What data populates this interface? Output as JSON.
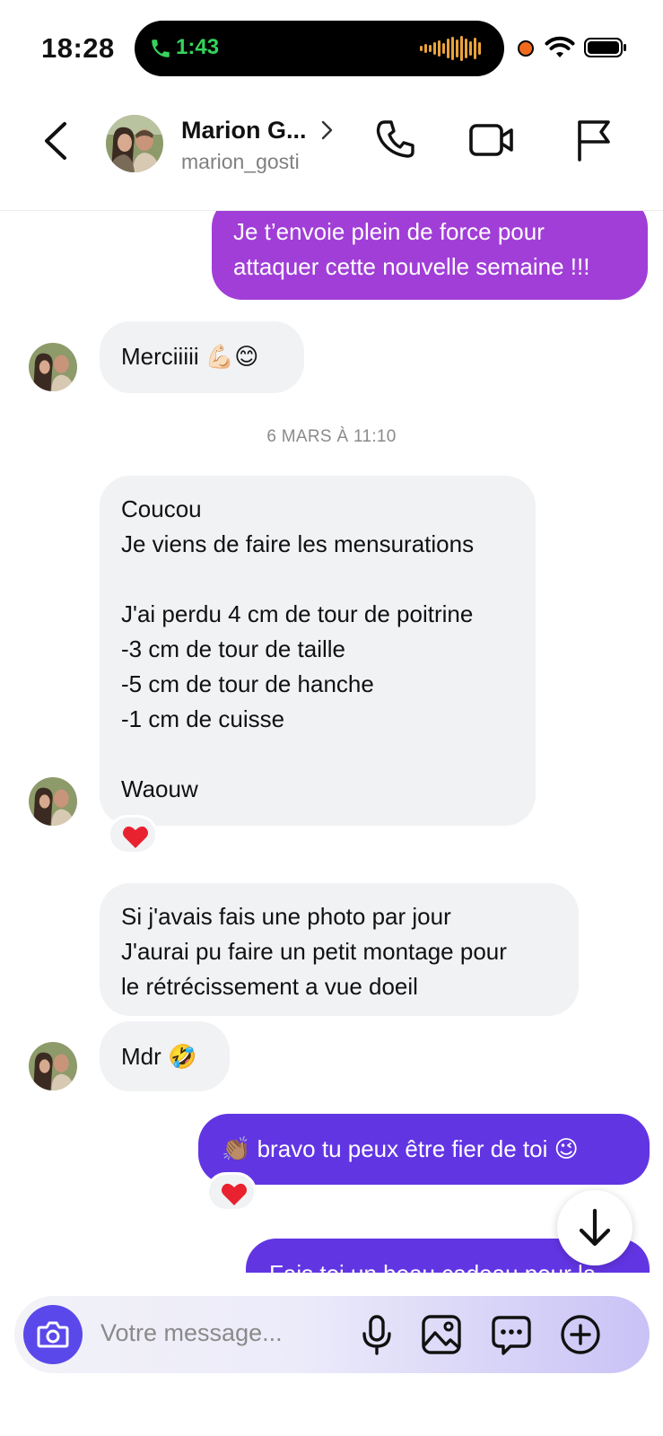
{
  "status_bar": {
    "time": "18:28",
    "call_duration": "1:43"
  },
  "header": {
    "name": "Marion G...",
    "username": "marion_gosti"
  },
  "messages": {
    "m1": "Je t’envoie plein de force pour\nattaquer cette nouvelle semaine !!!",
    "m2": "Merciiiii 💪🏻😊",
    "date_sep": "6 MARS À 11:10",
    "m3": "Coucou\nJe viens de faire les mensurations\n\nJ'ai perdu 4 cm de tour de poitrine\n-3 cm de tour de taille\n-5 cm de tour de hanche\n-1 cm de cuisse\n\nWaouw",
    "m4": "Si j'avais fais une photo par jour\nJ'aurai pu faire un petit montage pour\nle rétrécissement a vue doeil",
    "m5": "Mdr 🤣",
    "m6": "👏🏽 bravo tu peux être fier de toi 😉",
    "m7": "Fais toi un beau cadeau pour la"
  },
  "reactions": {
    "heart": "❤️"
  },
  "composer": {
    "placeholder": "Votre message..."
  },
  "colors": {
    "outgoing_purple": "#a13ed7",
    "outgoing_violet": "#6235e3",
    "incoming": "#f1f2f4",
    "accent": "#5a48ea",
    "call_green": "#35d35b"
  },
  "icons": [
    "phone-icon",
    "back-chevron-icon",
    "video-icon",
    "flag-icon",
    "scroll-down-arrow-icon",
    "camera-icon",
    "microphone-icon",
    "image-icon",
    "sticker-icon",
    "plus-icon",
    "wifi-icon",
    "battery-icon"
  ]
}
